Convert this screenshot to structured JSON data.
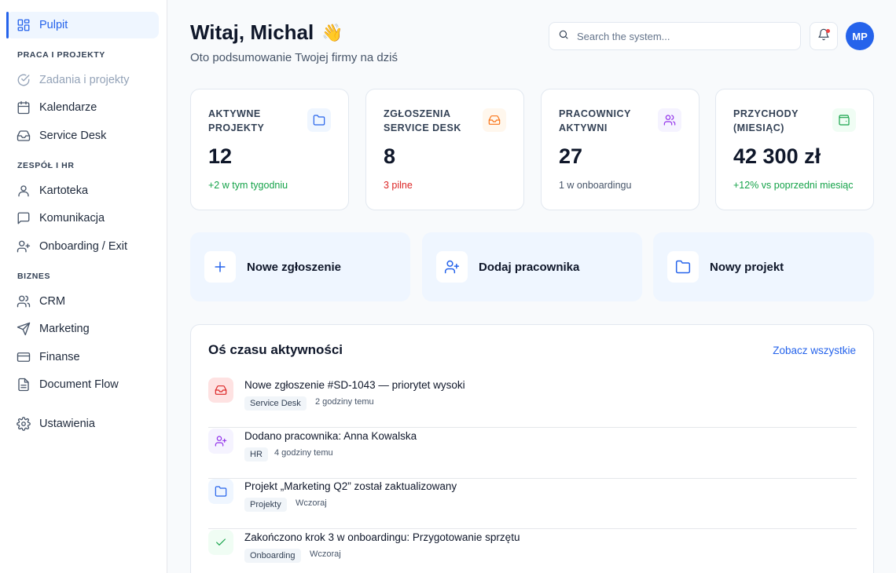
{
  "sidebar": {
    "dashboard": "Pulpit",
    "sections": {
      "work": "PRACA I PROJEKTY",
      "team": "ZESPÓŁ I HR",
      "business": "BIZNES"
    },
    "items": {
      "tasks": "Zadania i projekty",
      "calendars": "Kalendarze",
      "servicedesk": "Service Desk",
      "records": "Kartoteka",
      "communication": "Komunikacja",
      "onboarding": "Onboarding / Exit",
      "crm": "CRM",
      "marketing": "Marketing",
      "finance": "Finanse",
      "docflow": "Document Flow",
      "settings": "Ustawienia"
    }
  },
  "header": {
    "greeting": "Witaj, Michal",
    "wave": "👋",
    "subtitle": "Oto podsumowanie Twojej firmy na dziś",
    "search_placeholder": "Search the system...",
    "avatar": "MP"
  },
  "stats": [
    {
      "label": "Aktywne projekty",
      "value": "12",
      "foot": "+2 w tym tygodniu",
      "icon": "folder-icon",
      "color": "#2563eb",
      "bg": "#eff6ff",
      "footColor": "#16a34a"
    },
    {
      "label": "Zgłoszenia Service Desk",
      "value": "8",
      "foot": "3 pilne",
      "icon": "inbox-icon",
      "color": "#f97316",
      "bg": "#fff7ed",
      "footColor": "#dc2626"
    },
    {
      "label": "Pracownicy aktywni",
      "value": "27",
      "foot": "1 w onboardingu",
      "icon": "users-icon",
      "color": "#9333ea",
      "bg": "#f5f3ff",
      "footColor": "#475569"
    },
    {
      "label": "Przychody (miesiąc)",
      "value": "42 300 zł",
      "foot": "+12% vs poprzedni miesiąc",
      "icon": "wallet-icon",
      "color": "#16a34a",
      "bg": "#f0fdf4",
      "footColor": "#16a34a"
    }
  ],
  "actions": {
    "new_ticket": "Nowe zgłoszenie",
    "add_employee": "Dodaj pracownika",
    "new_project": "Nowy projekt"
  },
  "timeline": {
    "title": "Oś czasu aktywności",
    "see_all": "Zobacz wszystkie",
    "items": [
      {
        "text": "Nowe zgłoszenie #SD-1043 — priorytet wysoki",
        "tag": "Service Desk",
        "time": "2 godziny temu",
        "icon": "inbox-icon"
      },
      {
        "text": "Dodano pracownika: Anna Kowalska",
        "tag": "HR",
        "time": "4 godziny temu",
        "icon": "user-plus-icon"
      },
      {
        "text": "Projekt „Marketing Q2” został zaktualizowany",
        "tag": "Projekty",
        "time": "Wczoraj",
        "icon": "folder-icon"
      },
      {
        "text": "Zakończono krok 3 w onboardingu: Przygotowanie sprzętu",
        "tag": "Onboarding",
        "time": "Wczoraj",
        "icon": "check-icon"
      }
    ]
  }
}
